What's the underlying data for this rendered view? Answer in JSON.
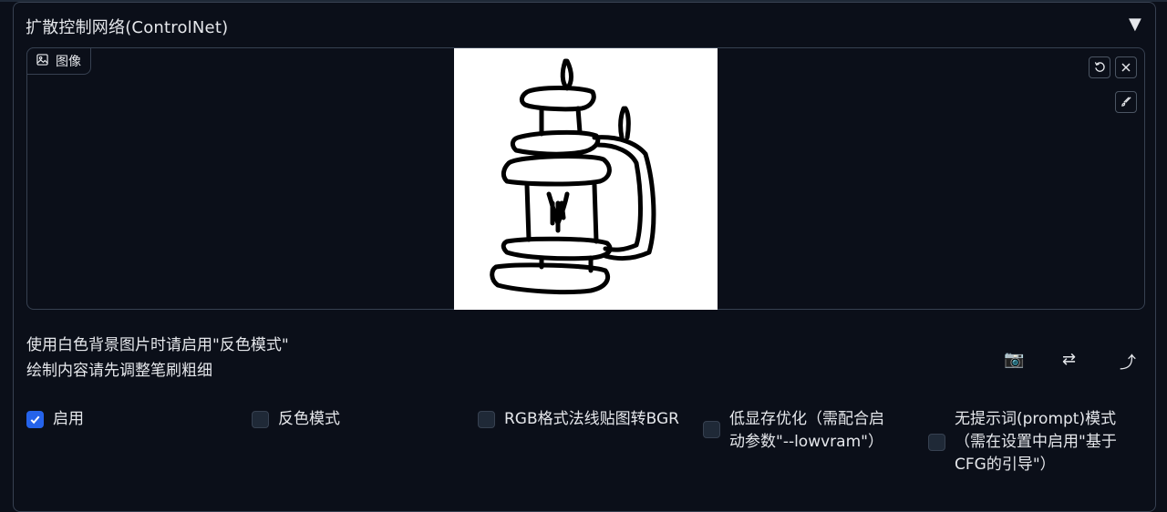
{
  "panel": {
    "title": "扩散控制网络(ControlNet)",
    "collapse_glyph": "▼"
  },
  "image": {
    "label": "图像",
    "label_icon": "image-icon",
    "buttons": [
      "undo-icon",
      "close-icon",
      "brush-icon"
    ]
  },
  "hints": {
    "line1": "使用白色背景图片时请启用\"反色模式\"",
    "line2": "绘制内容请先调整笔刷粗细"
  },
  "tools": {
    "camera": "📷",
    "swap": "⇄",
    "send": "⤴"
  },
  "options": [
    {
      "label": "启用",
      "checked": true
    },
    {
      "label": "反色模式",
      "checked": false
    },
    {
      "label": "RGB格式法线贴图转BGR",
      "checked": false
    },
    {
      "label": "低显存优化（需配合启动参数\"--lowvram\"）",
      "checked": false
    },
    {
      "label": "无提示词(prompt)模式（需在设置中启用\"基于CFG的引导\"）",
      "checked": false
    }
  ]
}
